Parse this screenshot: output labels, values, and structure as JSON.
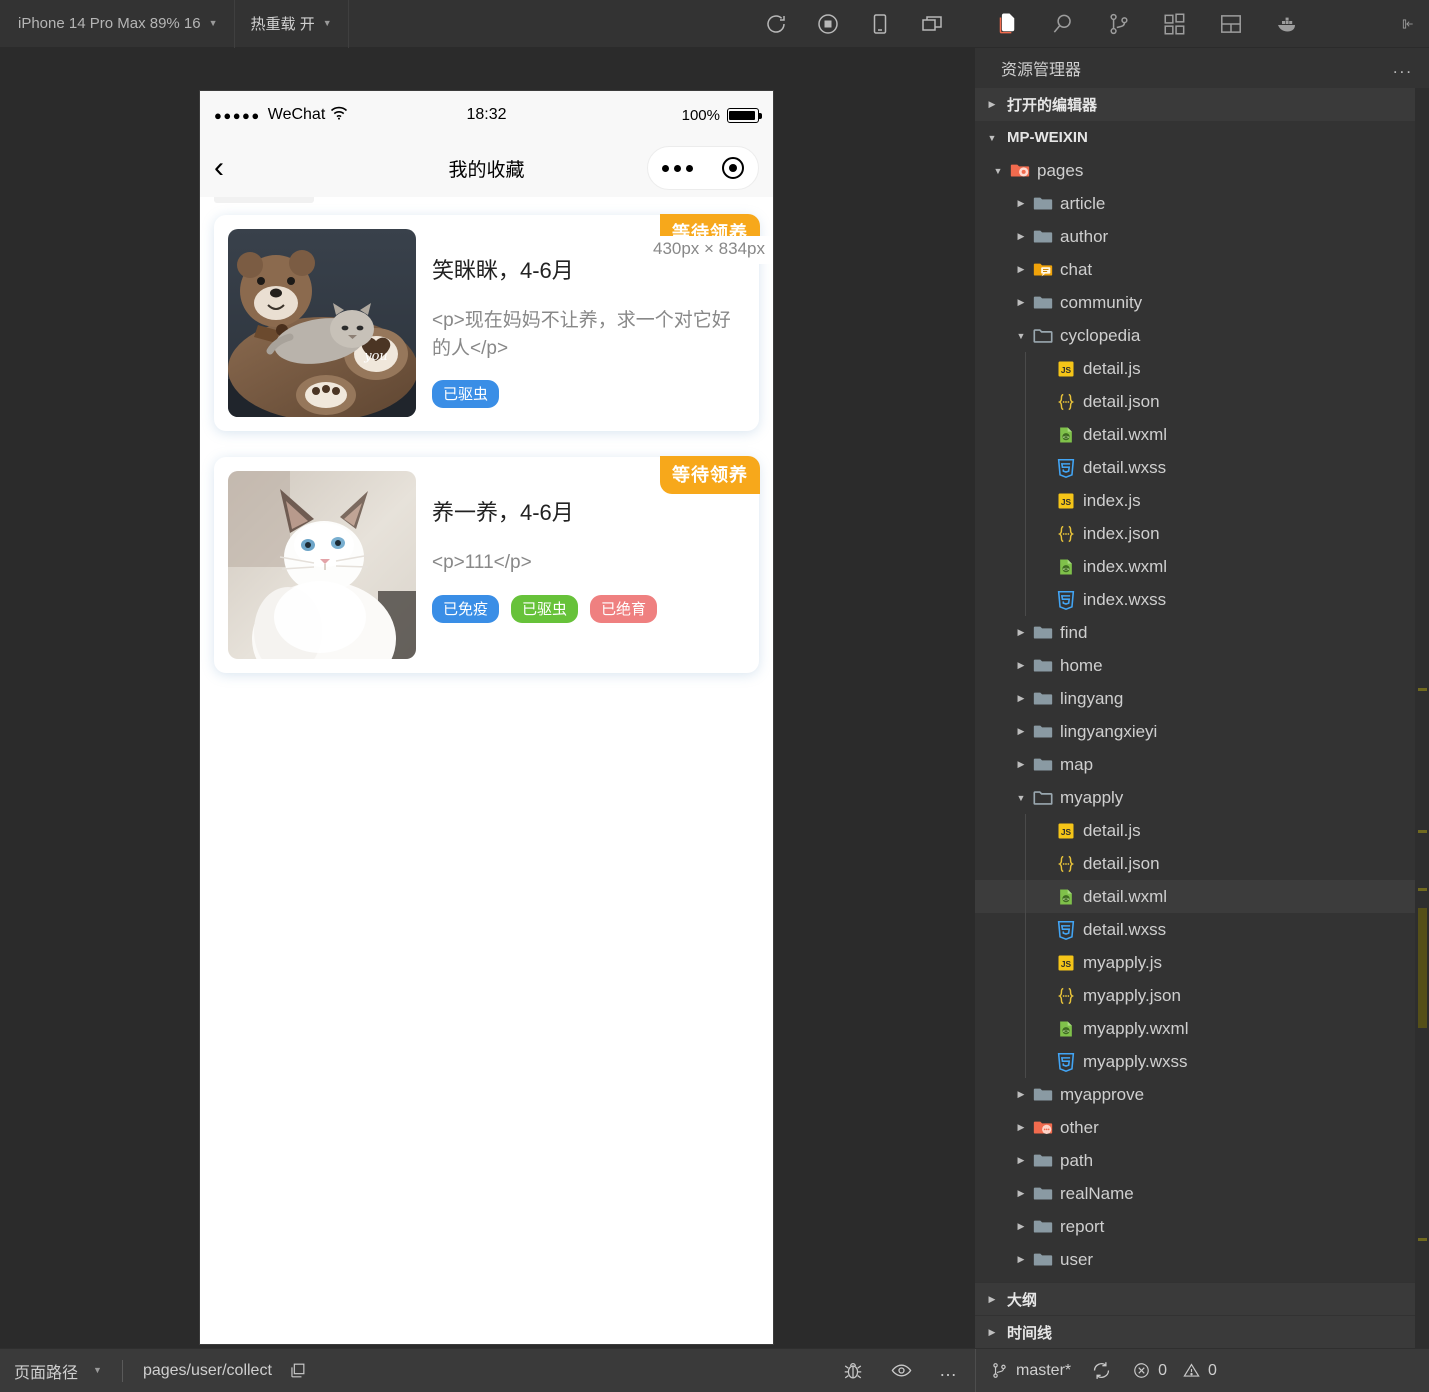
{
  "simulator_toolbar": {
    "device": "iPhone 14 Pro Max 89% 16",
    "hot_reload": "热重载 开",
    "icons": [
      "refresh-icon",
      "record-stop-icon",
      "mobile-icon",
      "windows-icon"
    ]
  },
  "activity_bar": {
    "icons": [
      "explorer-icon",
      "search-icon",
      "source-control-icon",
      "extensions-icon",
      "layout-icon",
      "docker-icon"
    ],
    "right_icon": "collapse-panel-icon"
  },
  "explorer": {
    "title": "资源管理器",
    "more_label": "...",
    "open_editors": "打开的编辑器",
    "project": "MP-WEIXIN",
    "outline": "大纲",
    "timeline": "时间线",
    "tree": [
      {
        "label": "pages",
        "depth": 1,
        "type": "folder-special",
        "state": "expanded"
      },
      {
        "label": "article",
        "depth": 2,
        "type": "folder",
        "state": "collapsed"
      },
      {
        "label": "author",
        "depth": 2,
        "type": "folder",
        "state": "collapsed"
      },
      {
        "label": "chat",
        "depth": 2,
        "type": "folder-chat",
        "state": "collapsed"
      },
      {
        "label": "community",
        "depth": 2,
        "type": "folder",
        "state": "collapsed"
      },
      {
        "label": "cyclopedia",
        "depth": 2,
        "type": "folder-open",
        "state": "expanded"
      },
      {
        "label": "detail.js",
        "depth": 3,
        "type": "js",
        "state": "leaf"
      },
      {
        "label": "detail.json",
        "depth": 3,
        "type": "json",
        "state": "leaf"
      },
      {
        "label": "detail.wxml",
        "depth": 3,
        "type": "wxml",
        "state": "leaf"
      },
      {
        "label": "detail.wxss",
        "depth": 3,
        "type": "wxss",
        "state": "leaf"
      },
      {
        "label": "index.js",
        "depth": 3,
        "type": "js",
        "state": "leaf"
      },
      {
        "label": "index.json",
        "depth": 3,
        "type": "json",
        "state": "leaf"
      },
      {
        "label": "index.wxml",
        "depth": 3,
        "type": "wxml",
        "state": "leaf"
      },
      {
        "label": "index.wxss",
        "depth": 3,
        "type": "wxss",
        "state": "leaf"
      },
      {
        "label": "find",
        "depth": 2,
        "type": "folder",
        "state": "collapsed"
      },
      {
        "label": "home",
        "depth": 2,
        "type": "folder",
        "state": "collapsed"
      },
      {
        "label": "lingyang",
        "depth": 2,
        "type": "folder",
        "state": "collapsed"
      },
      {
        "label": "lingyangxieyi",
        "depth": 2,
        "type": "folder",
        "state": "collapsed"
      },
      {
        "label": "map",
        "depth": 2,
        "type": "folder",
        "state": "collapsed"
      },
      {
        "label": "myapply",
        "depth": 2,
        "type": "folder-open",
        "state": "expanded"
      },
      {
        "label": "detail.js",
        "depth": 3,
        "type": "js",
        "state": "leaf"
      },
      {
        "label": "detail.json",
        "depth": 3,
        "type": "json",
        "state": "leaf"
      },
      {
        "label": "detail.wxml",
        "depth": 3,
        "type": "wxml",
        "state": "leaf",
        "selected": true
      },
      {
        "label": "detail.wxss",
        "depth": 3,
        "type": "wxss",
        "state": "leaf"
      },
      {
        "label": "myapply.js",
        "depth": 3,
        "type": "js",
        "state": "leaf"
      },
      {
        "label": "myapply.json",
        "depth": 3,
        "type": "json",
        "state": "leaf"
      },
      {
        "label": "myapply.wxml",
        "depth": 3,
        "type": "wxml",
        "state": "leaf"
      },
      {
        "label": "myapply.wxss",
        "depth": 3,
        "type": "wxss",
        "state": "leaf"
      },
      {
        "label": "myapprove",
        "depth": 2,
        "type": "folder",
        "state": "collapsed"
      },
      {
        "label": "other",
        "depth": 2,
        "type": "folder-other",
        "state": "collapsed"
      },
      {
        "label": "path",
        "depth": 2,
        "type": "folder",
        "state": "collapsed"
      },
      {
        "label": "realName",
        "depth": 2,
        "type": "folder",
        "state": "collapsed"
      },
      {
        "label": "report",
        "depth": 2,
        "type": "folder",
        "state": "collapsed"
      },
      {
        "label": "user",
        "depth": 2,
        "type": "folder",
        "state": "collapsed"
      }
    ]
  },
  "phone": {
    "status": {
      "signal_dots": "●●●●●",
      "carrier": "WeChat",
      "time": "18:32",
      "battery_percent": "100%"
    },
    "nav": {
      "back_icon": "chevron-left-icon",
      "title": "我的收藏"
    },
    "size_badge": "430px × 834px",
    "cards": [
      {
        "ribbon": "等待领养",
        "title": "笑眯眯，4-6月",
        "desc": "<p>现在妈妈不让养，求一个对它好的人</p>",
        "image": "teddy-bear-with-cat-photo",
        "tags": [
          {
            "label": "已驱虫",
            "color": "blue"
          }
        ]
      },
      {
        "ribbon": "等待领养",
        "title": "养一养，4-6月",
        "desc": "<p>111</p>",
        "image": "white-ragdoll-cat-photo",
        "tags": [
          {
            "label": "已免疫",
            "color": "blue"
          },
          {
            "label": "已驱虫",
            "color": "green"
          },
          {
            "label": "已绝育",
            "color": "red"
          }
        ]
      }
    ]
  },
  "statusbar": {
    "page_path_label": "页面路径",
    "page_path_value": "pages/user/collect",
    "copy_icon": "copy-icon",
    "icons": [
      "debug-icon",
      "eye-icon",
      "more-icon"
    ],
    "branch": "master*",
    "sync_icon": "sync-icon",
    "errors": "0",
    "warnings": "0"
  },
  "colors": {
    "ribbon": "#f7a81b",
    "tag_blue": "#3a8ee6",
    "tag_green": "#67c23a",
    "tag_red": "#ef8080",
    "accent_folder": "#f26b4e",
    "ide_bg": "#333333",
    "stage_bg": "#2b2b2b"
  }
}
